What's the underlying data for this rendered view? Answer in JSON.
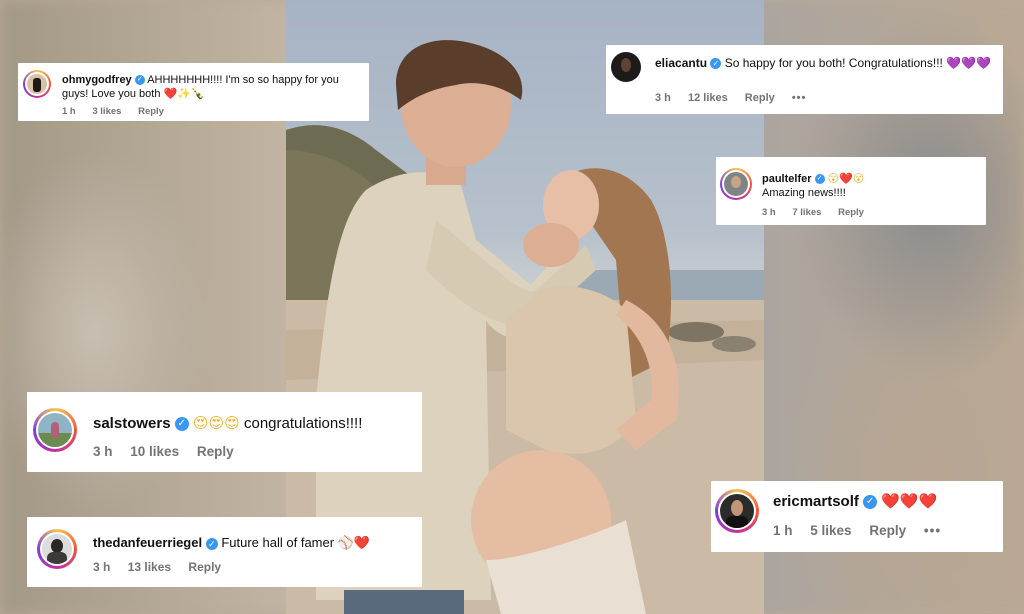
{
  "comments": [
    {
      "username": "ohmygodfrey",
      "text": "AHHHHHHH!!!! I'm so so happy for you guys! Love you both",
      "emoji": "❤️✨🍾",
      "time": "1 h",
      "likes": "3 likes",
      "reply": "Reply"
    },
    {
      "username": "eliacantu",
      "text": "So happy for you both! Congratulations!!!",
      "emoji": "💜💜💜",
      "time": "3 h",
      "likes": "12 likes",
      "reply": "Reply",
      "more": "•••"
    },
    {
      "username": "paultelfer",
      "emoji": "😮❤️😮",
      "text": "Amazing news!!!!",
      "time": "3 h",
      "likes": "7 likes",
      "reply": "Reply"
    },
    {
      "username": "salstowers",
      "emoji": "😍😍😍",
      "text": "congratulations!!!!",
      "time": "3 h",
      "likes": "10 likes",
      "reply": "Reply"
    },
    {
      "username": "thedanfeuerriegel",
      "text": "Future hall of famer",
      "emoji": "⚾❤️",
      "time": "3 h",
      "likes": "13 likes",
      "reply": "Reply"
    },
    {
      "username": "ericmartsolf",
      "emoji": "❤️❤️❤️",
      "time": "1 h",
      "likes": "5 likes",
      "reply": "Reply",
      "more": "•••"
    }
  ],
  "icons": {
    "verified": "verified-badge-icon",
    "more": "more-options-icon"
  },
  "colors": {
    "verified_blue": "#3897f0",
    "meta_gray": "#737373",
    "story_ring": "#c22ea3"
  }
}
